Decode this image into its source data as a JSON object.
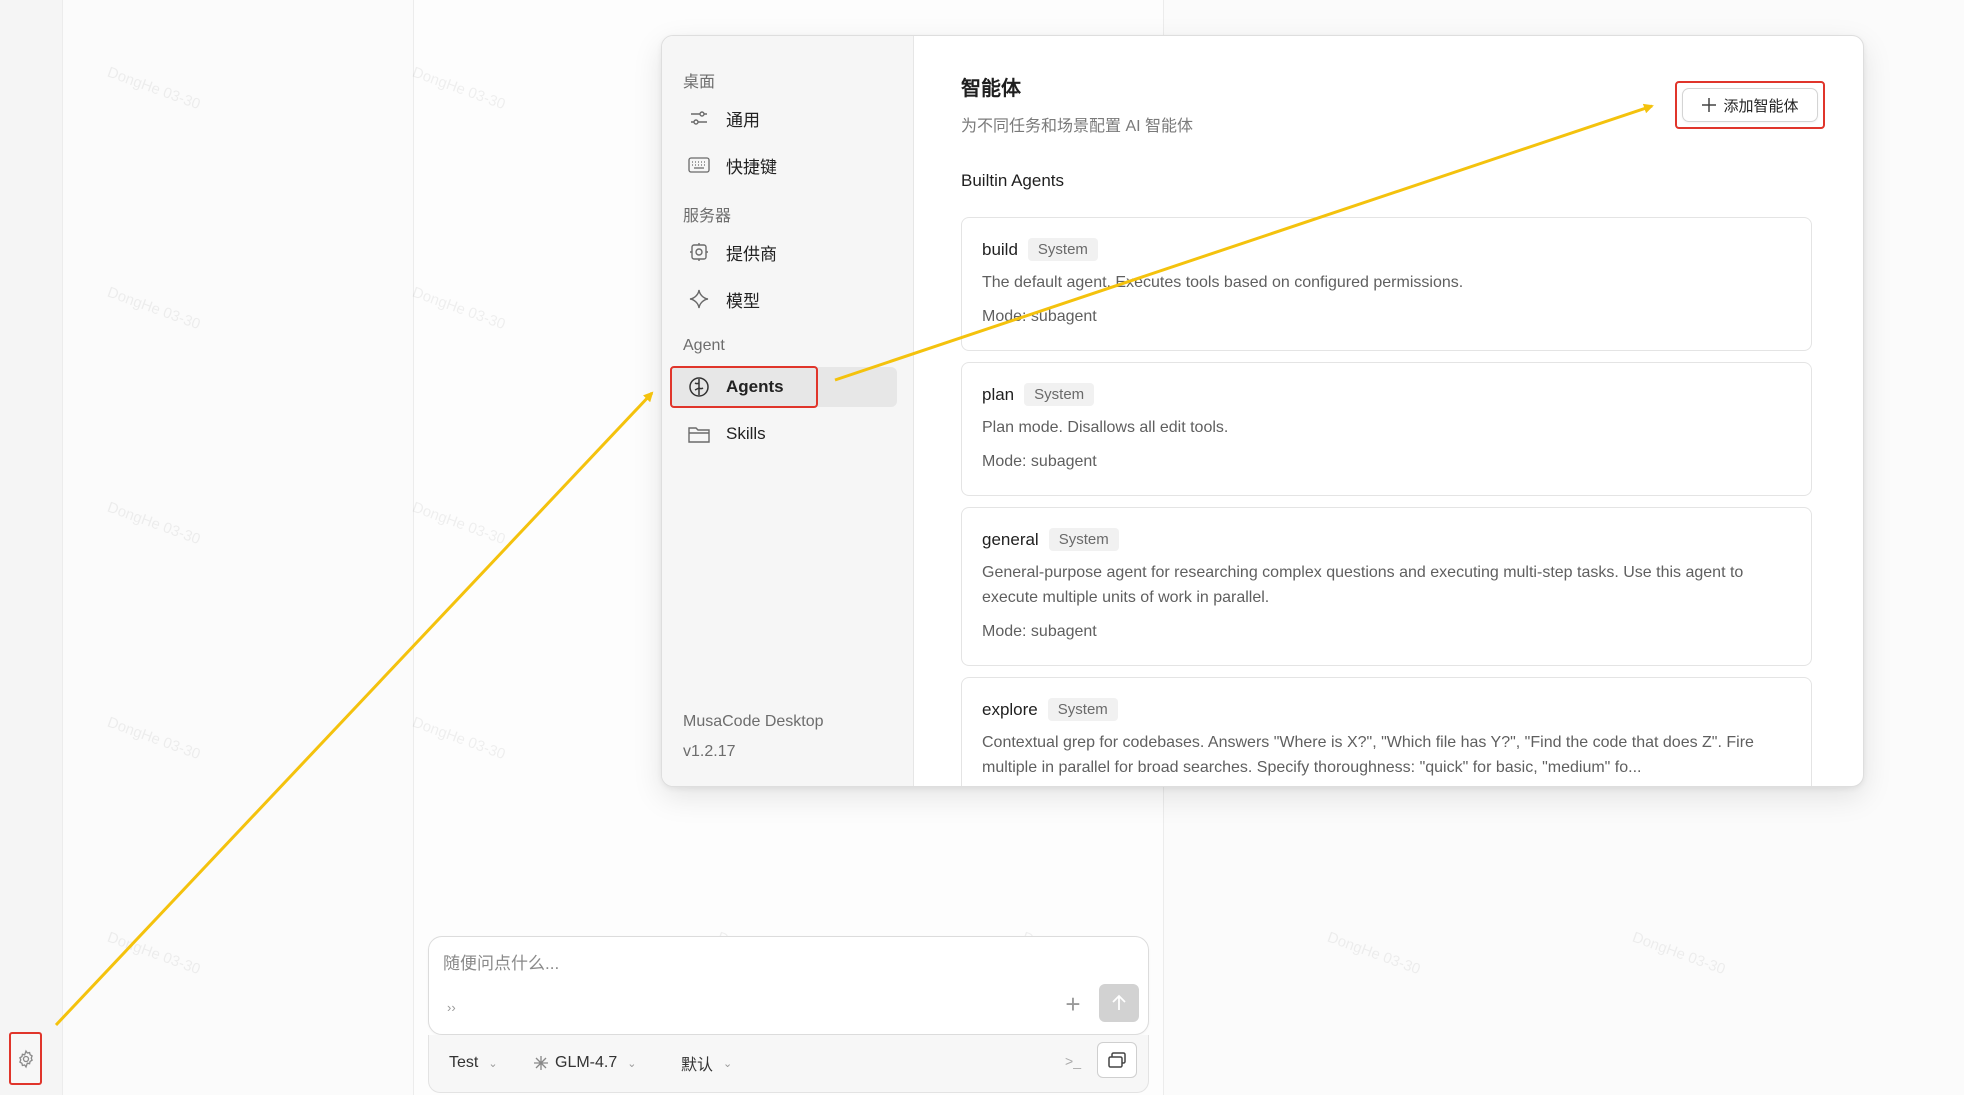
{
  "watermark": "DongHe 03-30",
  "colors": {
    "highlight": "#e0352b",
    "arrow": "#f4c20d",
    "accent_nav_bg": "#e7e7e7"
  },
  "rail": {
    "settings_icon": "gear-icon"
  },
  "composer": {
    "placeholder": "随便问点什么...",
    "mode_glyph": "››",
    "plus_glyph": "+",
    "bottom": {
      "agent_label": "Test",
      "model_label": "GLM-4.7",
      "variant_label": "默认",
      "terminal_glyph": ">_"
    }
  },
  "settings": {
    "nav": {
      "groups": [
        {
          "title": "桌面",
          "items": [
            {
              "label": "通用",
              "icon": "sliders-icon"
            },
            {
              "label": "快捷键",
              "icon": "keyboard-icon"
            }
          ]
        },
        {
          "title": "服务器",
          "items": [
            {
              "label": "提供商",
              "icon": "provider-icon"
            },
            {
              "label": "模型",
              "icon": "sparkle-icon"
            }
          ]
        },
        {
          "title": "Agent",
          "items": [
            {
              "label": "Agents",
              "icon": "brain-icon",
              "active": true
            },
            {
              "label": "Skills",
              "icon": "folder-icon"
            }
          ]
        }
      ],
      "app_name": "MusaCode Desktop",
      "app_version": "v1.2.17"
    },
    "content": {
      "title": "智能体",
      "subtitle": "为不同任务和场景配置 AI 智能体",
      "add_button": "添加智能体",
      "section_title": "Builtin Agents",
      "agents": [
        {
          "name": "build",
          "badge": "System",
          "description": "The default agent. Executes tools based on configured permissions.",
          "mode": "Mode: subagent"
        },
        {
          "name": "plan",
          "badge": "System",
          "description": "Plan mode. Disallows all edit tools.",
          "mode": "Mode: subagent"
        },
        {
          "name": "general",
          "badge": "System",
          "description": "General-purpose agent for researching complex questions and executing multi-step tasks. Use this agent to execute multiple units of work in parallel.",
          "mode": "Mode: subagent"
        },
        {
          "name": "explore",
          "badge": "System",
          "description": "Contextual grep for codebases. Answers \"Where is X?\", \"Which file has Y?\", \"Find the code that does Z\". Fire multiple in parallel for broad searches. Specify thoroughness: \"quick\" for basic, \"medium\" fo..."
        }
      ]
    }
  }
}
